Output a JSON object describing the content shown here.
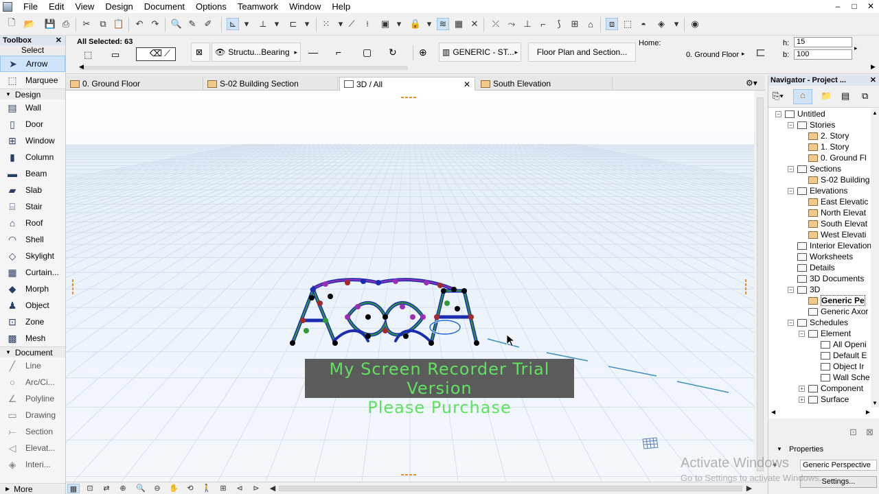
{
  "menu": {
    "items": [
      "File",
      "Edit",
      "View",
      "Design",
      "Document",
      "Options",
      "Teamwork",
      "Window",
      "Help"
    ]
  },
  "window_controls": {
    "minimize": "–",
    "maximize": "□",
    "close": "✕"
  },
  "toolbox": {
    "title": "Toolbox",
    "select_label": "Select",
    "select_tools": [
      {
        "label": "Arrow",
        "icon": "arrow-icon",
        "selected": true
      },
      {
        "label": "Marquee",
        "icon": "marquee-icon"
      }
    ],
    "design_label": "Design",
    "design_tools": [
      {
        "label": "Wall",
        "icon": "wall-icon"
      },
      {
        "label": "Door",
        "icon": "door-icon"
      },
      {
        "label": "Window",
        "icon": "window-icon"
      },
      {
        "label": "Column",
        "icon": "column-icon"
      },
      {
        "label": "Beam",
        "icon": "beam-icon"
      },
      {
        "label": "Slab",
        "icon": "slab-icon"
      },
      {
        "label": "Stair",
        "icon": "stair-icon"
      },
      {
        "label": "Roof",
        "icon": "roof-icon"
      },
      {
        "label": "Shell",
        "icon": "shell-icon"
      },
      {
        "label": "Skylight",
        "icon": "skylight-icon"
      },
      {
        "label": "Curtain...",
        "icon": "curtain-wall-icon"
      },
      {
        "label": "Morph",
        "icon": "morph-icon"
      },
      {
        "label": "Object",
        "icon": "object-icon"
      },
      {
        "label": "Zone",
        "icon": "zone-icon"
      },
      {
        "label": "Mesh",
        "icon": "mesh-icon"
      }
    ],
    "document_label": "Document",
    "document_tools": [
      {
        "label": "Line",
        "icon": "line-icon"
      },
      {
        "label": "Arc/Ci...",
        "icon": "arc-icon"
      },
      {
        "label": "Polyline",
        "icon": "polyline-icon"
      },
      {
        "label": "Drawing",
        "icon": "drawing-icon"
      },
      {
        "label": "Section",
        "icon": "section-icon"
      },
      {
        "label": "Elevat...",
        "icon": "elevation-icon"
      },
      {
        "label": "Interi...",
        "icon": "interior-elevation-icon"
      }
    ],
    "more_label": "More"
  },
  "infobox": {
    "selection": "All Selected: 63",
    "structure": "Structu...Bearing",
    "surface": "GENERIC - ST...",
    "floorplan": "Floor Plan and Section...",
    "home_label": "Home:",
    "home_value": "0. Ground Floor",
    "h_label": "h:",
    "h_value": "15",
    "b_label": "b:",
    "b_value": "100"
  },
  "tabs": [
    {
      "label": "0. Ground Floor",
      "active": false
    },
    {
      "label": "S-02 Building Section",
      "active": false
    },
    {
      "label": "3D / All",
      "active": true
    },
    {
      "label": "South Elevation",
      "active": false
    }
  ],
  "tab_close": "✕",
  "viewport": {
    "watermark_line1": "My Screen Recorder Trial Version",
    "watermark_line2": "Please Purchase"
  },
  "navigator": {
    "title": "Navigator - Project ...",
    "nodes": [
      {
        "label": "Untitled",
        "level": 0,
        "toggle": "−"
      },
      {
        "label": "Stories",
        "level": 1,
        "toggle": "−"
      },
      {
        "label": "2. Story",
        "level": 2,
        "brown": true
      },
      {
        "label": "1. Story",
        "level": 2,
        "brown": true
      },
      {
        "label": "0. Ground Fl",
        "level": 2,
        "brown": true
      },
      {
        "label": "Sections",
        "level": 1,
        "toggle": "−"
      },
      {
        "label": "S-02 Building",
        "level": 2,
        "brown": true
      },
      {
        "label": "Elevations",
        "level": 1,
        "toggle": "−"
      },
      {
        "label": "East Elevatic",
        "level": 2,
        "brown": true
      },
      {
        "label": "North Elevat",
        "level": 2,
        "brown": true
      },
      {
        "label": "South Elevat",
        "level": 2,
        "brown": true
      },
      {
        "label": "West Elevati",
        "level": 2,
        "brown": true
      },
      {
        "label": "Interior Elevation",
        "level": 1
      },
      {
        "label": "Worksheets",
        "level": 1
      },
      {
        "label": "Details",
        "level": 1
      },
      {
        "label": "3D Documents",
        "level": 1
      },
      {
        "label": "3D",
        "level": 1,
        "toggle": "−"
      },
      {
        "label": "Generic Pe",
        "level": 2,
        "brown": true,
        "bold": true
      },
      {
        "label": "Generic Axor",
        "level": 2
      },
      {
        "label": "Schedules",
        "level": 1,
        "toggle": "−"
      },
      {
        "label": "Element",
        "level": 2,
        "toggle": "−"
      },
      {
        "label": "All Openi",
        "level": 3
      },
      {
        "label": "Default E",
        "level": 3
      },
      {
        "label": "Object Ir",
        "level": 3
      },
      {
        "label": "Wall Sche",
        "level": 3
      },
      {
        "label": "Component",
        "level": 2,
        "toggle": "+"
      },
      {
        "label": "Surface",
        "level": 2,
        "toggle": "+"
      }
    ]
  },
  "properties": {
    "header": "Properties",
    "view_name": "Generic Perspective",
    "settings_button": "Settings..."
  },
  "os_overlay": {
    "activate_title": "Activate Windows",
    "activate_sub": "Go to Settings to activate Windows."
  }
}
